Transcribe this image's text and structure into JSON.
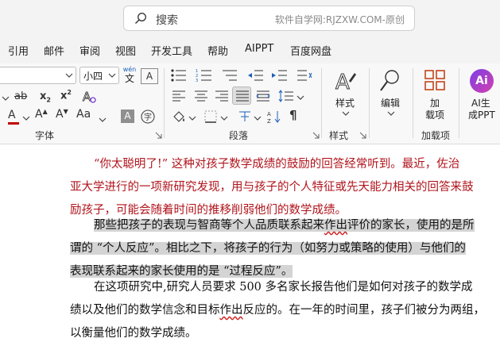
{
  "search": {
    "placeholder": "搜索",
    "brand_text": "软件自学网:RJZXW.COM-原创"
  },
  "menu": {
    "tabs": [
      "引用",
      "邮件",
      "审阅",
      "视图",
      "开发工具",
      "帮助",
      "AIPPT",
      "百度网盘"
    ]
  },
  "ribbon": {
    "font_size_value": "小四",
    "font_group_label": "字体",
    "paragraph_group_label": "段落",
    "styles_group_label": "样式",
    "addins_group_label": "加载项",
    "styles_button_label": "样式",
    "edit_button_label": "编辑",
    "addins_button_label": [
      "加",
      "载项"
    ],
    "ai_button_label": [
      "AI生",
      "成PPT"
    ],
    "ai_badge_text": "Ai",
    "wen_top": "wén",
    "wen_bottom": "文",
    "aa_label": "A",
    "font_color": "#c00000",
    "highlight_letter": "A"
  },
  "document": {
    "para1": [
      "“你太聪明了!” 这种对孩子数学成绩的鼓励的回答经常听到。最近，佐治",
      "亚大学进行的一项新研究发现，用与孩子的个人特征或先天能力相关的回答来鼓",
      "励孩子，可能会随着时间的推移削弱他们的数学成绩。"
    ],
    "para2": {
      "l1_a": "那些把孩子的表现与智商等个人品质联系起来",
      "l1_wavy": "作出",
      "l1_b": "评价的家长，使用的是所",
      "l2": "谓的 “个人反应”。相比之下，将孩子的行为（如努力或策略的使用）与他们的",
      "l3": "表现联系起来的家长使用的是 “过程反应”。"
    },
    "para3": {
      "l1": "在这项研究中,研究人员要求 500 多名家长报告他们是如何对孩子的数学成",
      "l2_a": "绩以及他们的数学信念和目标",
      "l2_wavy": "作出",
      "l2_b": "反应的。在一年的时间里，孩子们被分为两组，",
      "l3": "以衡量他们的数学成绩。"
    }
  }
}
